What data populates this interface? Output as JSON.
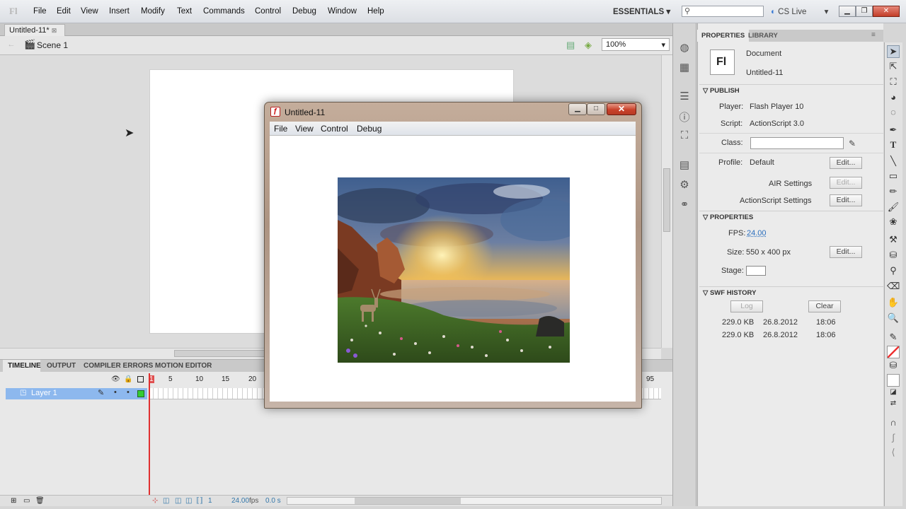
{
  "app": {
    "logo": "Fl",
    "menu": [
      "File",
      "Edit",
      "View",
      "Insert",
      "Modify",
      "Text",
      "Commands",
      "Control",
      "Debug",
      "Window",
      "Help"
    ],
    "workspace": "ESSENTIALS",
    "cslive": "CS Live"
  },
  "document": {
    "tab": "Untitled-11*",
    "scene": "Scene 1",
    "zoom": "100%"
  },
  "timeline": {
    "tabs": [
      "TIMELINE",
      "OUTPUT",
      "COMPILER ERRORS",
      "MOTION EDITOR"
    ],
    "layer": "Layer 1",
    "ruler": [
      "1",
      "5",
      "10",
      "15",
      "20",
      "95"
    ],
    "footer": {
      "frame": "1",
      "fps": "24.00",
      "fps_unit": "fps",
      "time": "0.0 s"
    }
  },
  "properties": {
    "tabs": [
      "PROPERTIES",
      "LIBRARY"
    ],
    "doc_logo": "Fl",
    "doc_type": "Document",
    "doc_name": "Untitled-11",
    "publish": {
      "header": "PUBLISH",
      "player_label": "Player:",
      "player": "Flash Player 10",
      "script_label": "Script:",
      "script": "ActionScript 3.0",
      "class_label": "Class:",
      "profile_label": "Profile:",
      "profile": "Default",
      "air": "AIR Settings",
      "as_settings": "ActionScript Settings",
      "edit": "Edit..."
    },
    "props": {
      "header": "PROPERTIES",
      "fps_label": "FPS:",
      "fps": "24.00",
      "size_label": "Size:",
      "size": "550 x 400 px",
      "stage_label": "Stage:",
      "edit": "Edit..."
    },
    "swf": {
      "header": "SWF HISTORY",
      "log": "Log",
      "clear": "Clear",
      "rows": [
        {
          "size": "229.0 KB",
          "date": "26.8.2012",
          "time": "18:06"
        },
        {
          "size": "229.0 KB",
          "date": "26.8.2012",
          "time": "18:06"
        }
      ]
    }
  },
  "swf_window": {
    "title": "Untitled-11",
    "menu": [
      "File",
      "View",
      "Control",
      "Debug"
    ],
    "icon": "flash-player-icon"
  }
}
